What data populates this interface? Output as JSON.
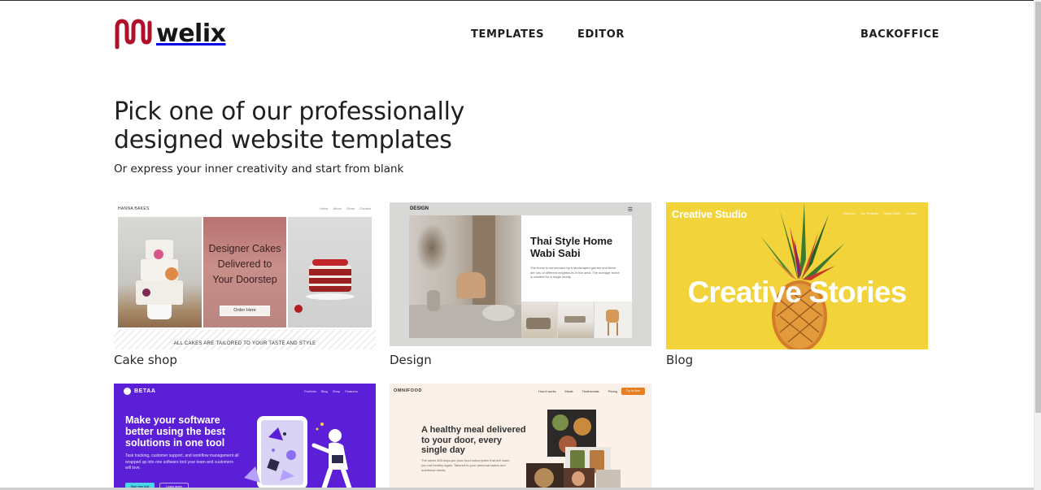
{
  "brand": {
    "name": "welix",
    "color": "#b0102a"
  },
  "nav": {
    "templates": "TEMPLATES",
    "editor": "EDITOR",
    "backoffice": "BACKOFFICE"
  },
  "hero": {
    "title": "Pick one of our professionally designed website templates",
    "subtitle": "Or express your inner creativity and start from blank"
  },
  "templates": [
    {
      "label": "Cake shop",
      "preview": {
        "brand": "HANNA BAKES",
        "nav": [
          "Home",
          "About",
          "Order",
          "Contact"
        ],
        "headline": "Designer Cakes Delivered to Your Doorstep",
        "button": "Order Here",
        "footer": "ALL CAKES ARE TAILORED TO YOUR TASTE AND STYLE"
      }
    },
    {
      "label": "Design",
      "preview": {
        "brand": "DESIGN",
        "headline": "Thai Style Home Wabi Sabi",
        "body": "The home is surrounded by a landscaped garden and there are lots of different neighbours in the area. The average home is created for a single family."
      }
    },
    {
      "label": "Blog",
      "preview": {
        "brand": "Creative Studio",
        "nav": [
          "About us",
          "Our Projects",
          "Single Story",
          "Contact"
        ],
        "headline": "Creative Stories"
      }
    },
    {
      "label": "",
      "preview": {
        "brand": "BETAA",
        "nav": [
          "Portfolio",
          "Blog",
          "Shop",
          "Features"
        ],
        "headline": "Make your software better using the best solutions in one tool",
        "body": "Task tracking, customer support, and workflow management all wrapped up into one software tool your team and customers will love.",
        "button": "Start free trial",
        "button2": "Learn more"
      }
    },
    {
      "label": "",
      "preview": {
        "brand": "OMNIFOOD",
        "nav": [
          "How it works",
          "Meals",
          "Testimonials",
          "Pricing"
        ],
        "cta": "Try for free",
        "headline": "A healthy meal delivered to your door, every single day",
        "body": "The smart 365-days-per-year food subscription that will make you eat healthy again. Tailored to your personal tastes and nutritional needs."
      }
    }
  ]
}
